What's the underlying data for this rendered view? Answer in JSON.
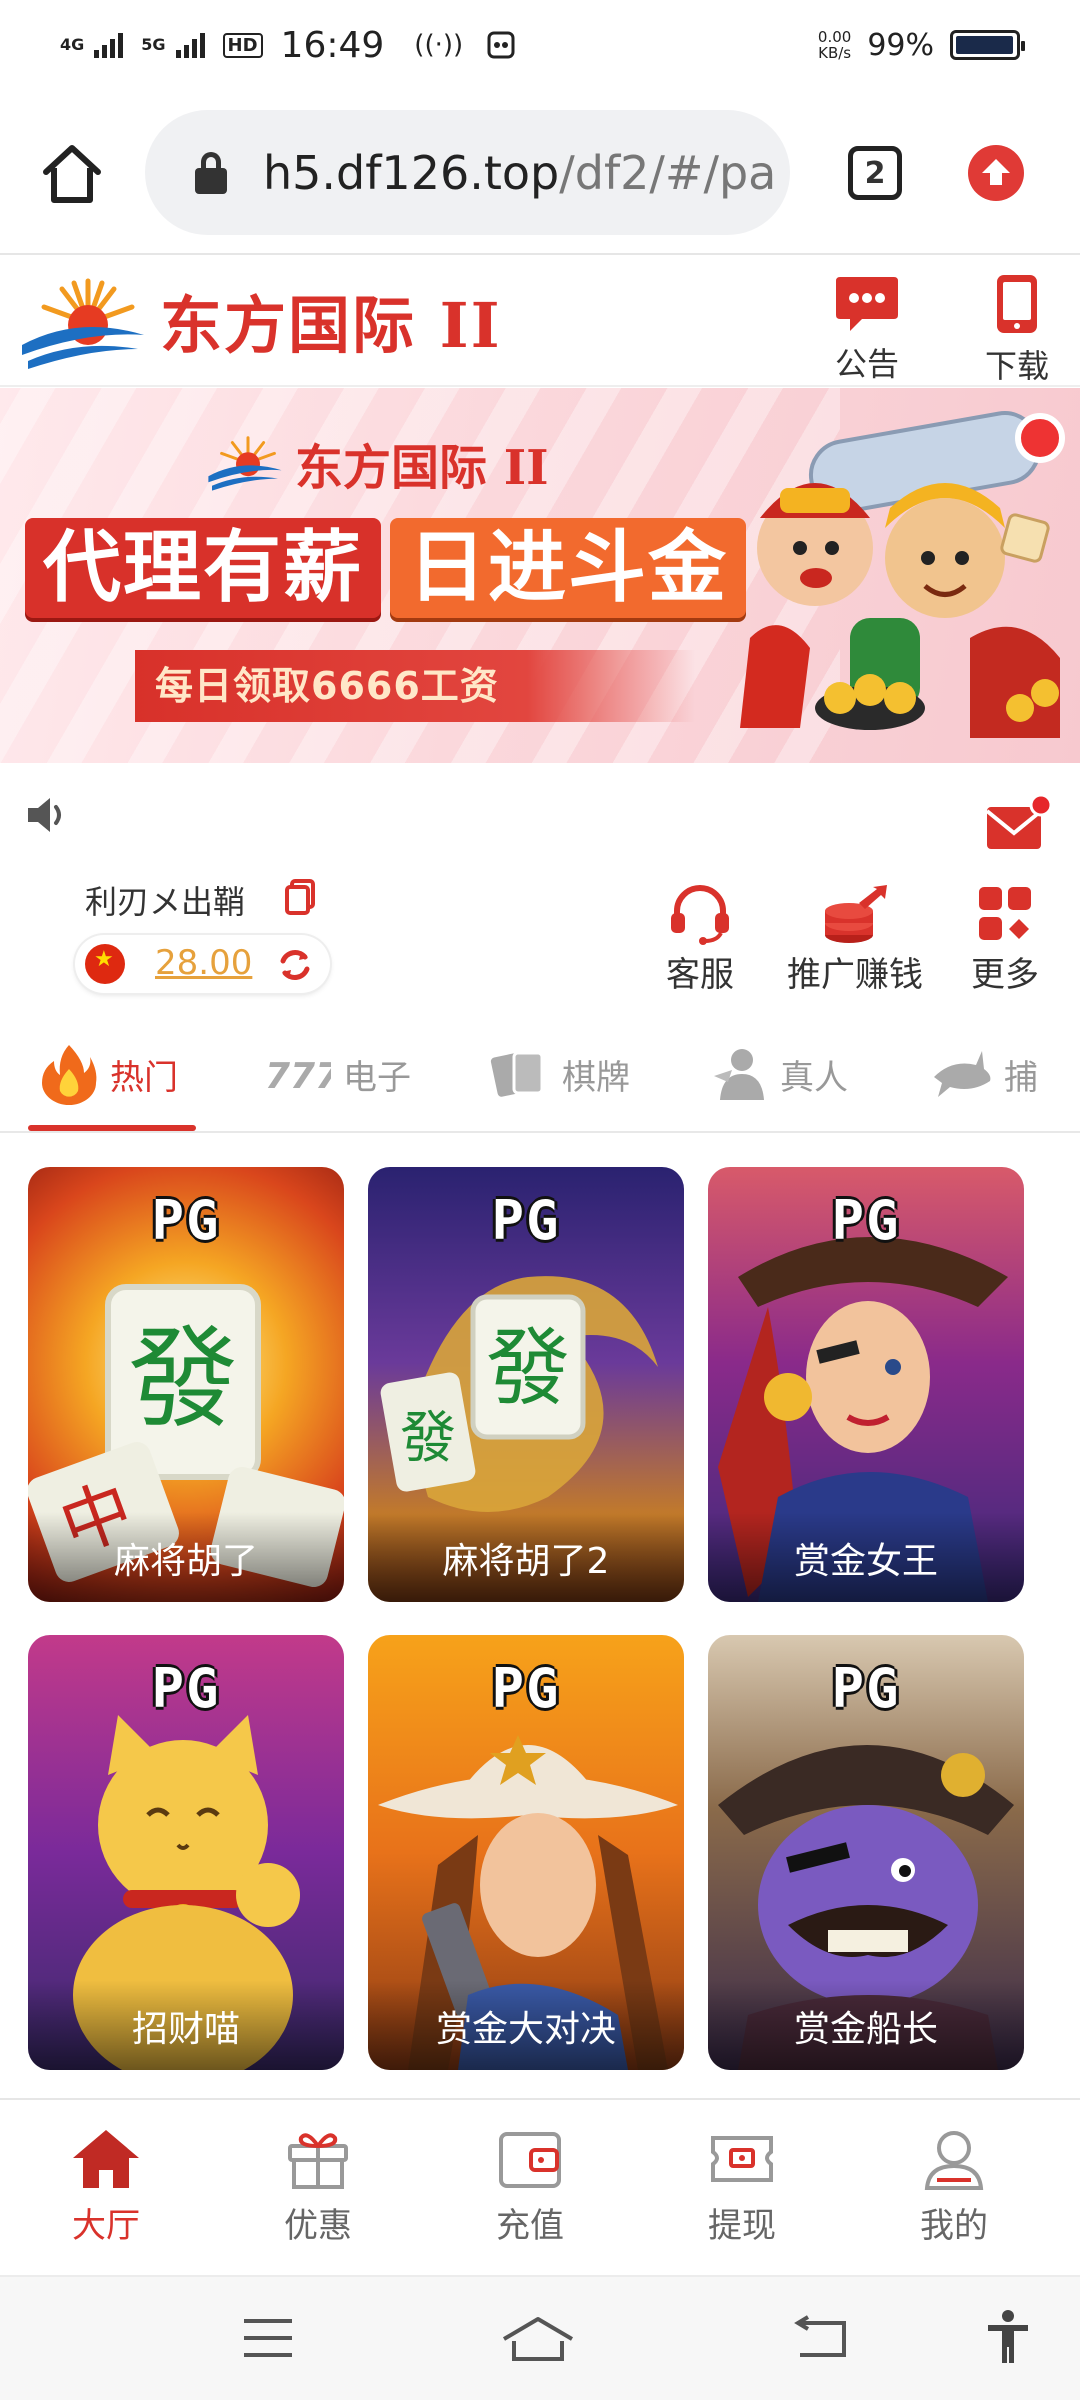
{
  "status_bar": {
    "net1": "4G",
    "net2": "5G",
    "hd": "HD",
    "time": "16:49",
    "speed_value": "0.00",
    "speed_unit": "KB/s",
    "battery_text": "99%",
    "battery_level": 0.99
  },
  "browser": {
    "url_host": "h5.df126.top",
    "url_path": "/df2/#/pa",
    "tab_count": "2"
  },
  "header": {
    "brand": "东方国际 II",
    "notice_label": "公告",
    "download_label": "下载",
    "accent_color": "#d9322b"
  },
  "banner": {
    "brand": "东方国际 II",
    "headline_left": "代理有薪",
    "headline_right": "日进斗金",
    "subline": "每日领取6666工资"
  },
  "user": {
    "name": "利刃メ出鞘",
    "balance": "28.00"
  },
  "actions": [
    {
      "label": "客服",
      "icon": "headset-icon"
    },
    {
      "label": "推广赚钱",
      "icon": "coins-icon"
    },
    {
      "label": "更多",
      "icon": "grid-icon"
    }
  ],
  "categories": [
    {
      "label": "热门",
      "icon": "fire-icon",
      "active": true
    },
    {
      "label": "电子",
      "icon": "slot-777-icon"
    },
    {
      "label": "棋牌",
      "icon": "cards-icon"
    },
    {
      "label": "真人",
      "icon": "dealer-icon"
    },
    {
      "label": "捕",
      "icon": "shark-icon"
    }
  ],
  "games": [
    {
      "provider": "PG",
      "title": "麻将胡了"
    },
    {
      "provider": "PG",
      "title": "麻将胡了2"
    },
    {
      "provider": "PG",
      "title": "赏金女王"
    },
    {
      "provider": "PG",
      "title": "招财喵"
    },
    {
      "provider": "PG",
      "title": "赏金大对决"
    },
    {
      "provider": "PG",
      "title": "赏金船长"
    }
  ],
  "bottom_nav": [
    {
      "label": "大厅",
      "icon": "home-icon",
      "active": true
    },
    {
      "label": "优惠",
      "icon": "gift-icon"
    },
    {
      "label": "充值",
      "icon": "wallet-icon"
    },
    {
      "label": "提现",
      "icon": "ticket-icon"
    },
    {
      "label": "我的",
      "icon": "user-icon"
    }
  ]
}
